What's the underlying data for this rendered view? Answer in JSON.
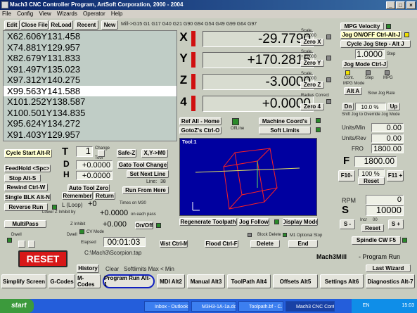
{
  "window": {
    "title": "Mach3 CNC Controller Program, ArtSoft Corporation, 2000 - 2004"
  },
  "menu": [
    "File",
    "Config",
    "View",
    "Wizards",
    "Operator",
    "Help"
  ],
  "toolbar": {
    "edit": "Edit",
    "close": "Close File",
    "reload": "ReLoad",
    "recent": "Recent",
    "new": "New"
  },
  "modal": "Mill->G15  G1 G17 G40 G21 G90 G94 G54 G49 G99 G64 G97",
  "gcode": [
    "X62.606Y131.458",
    "X74.881Y129.957",
    "X82.679Y131.833",
    "X91.497Y135.023",
    "X97.312Y140.275",
    "X99.563Y141.588",
    "X101.252Y138.587",
    "X100.501Y134.835",
    "X95.624Y134.272",
    "X91.403Y129.957"
  ],
  "gcode_selected": 5,
  "axes": [
    {
      "label": "X",
      "value": "-29.7790",
      "scale": "Scale",
      "scale_val": "+1.0000",
      "zero": "Zero X"
    },
    {
      "label": "Y",
      "value": "+170.2815",
      "scale": "Scale",
      "scale_val": "+1.0000",
      "zero": "Zero Y"
    },
    {
      "label": "Z",
      "value": "-3.0000",
      "scale": "Scale",
      "scale_val": "+1.0000",
      "zero": "Zero Z"
    },
    {
      "label": "4",
      "value": "+0.0000",
      "scale": "Radius Correct",
      "scale_val": "",
      "zero": "Zero 4"
    }
  ],
  "right": {
    "mpg_velocity": "MPG Velocity",
    "jog_toggle": "Jog ON/OFF Ctrl-Alt-J",
    "jog_step": "Cycle Jog Step - Alt J",
    "step_val": "1.0000",
    "step_label": "Step",
    "jog_mode": "Jog Mode Ctrl-J",
    "cont": "Cont.",
    "step": "Step",
    "mpg": "MPG",
    "mpg_mode": "MPG Mode",
    "alt_a": "Alt A",
    "slow_jog": "Slow Jog Rate",
    "minus": "Dn",
    "jog_pct": "10.0 %",
    "plus": "Up",
    "shift_jog": "Shift Jog to Override Jog Mode"
  },
  "ref": {
    "ref_all": "Ref All - Home",
    "goto_z": "GotoZ's Ctrl-O",
    "offline": "OffLine",
    "machine_coords": "Machine Coord's",
    "soft_limits": "Soft Limits"
  },
  "feed": {
    "units_min_label": "Units/Min",
    "units_min": "0.00",
    "units_rev_label": "Units/Rev",
    "units_rev": "0.00",
    "fro_label": "FRO",
    "fro": "1800.00",
    "f_label": "F",
    "f_val": "1800.00",
    "pct": "100 %",
    "reset": "Reset",
    "f10": "F10-",
    "f11": "F11 +"
  },
  "spindle": {
    "rpm_label": "RPM",
    "rpm": "0",
    "s_label": "S",
    "s_val": "10000",
    "minus": "S -",
    "plus": "S +",
    "incr": "Incr",
    "incr_val": "00",
    "reset": "Reset",
    "spindle_btn": "Spindle CW F5"
  },
  "cycle": {
    "start": "Cycle Start Alt-R",
    "feedhold": "FeedHold <Spc>",
    "stop": "Stop Alt-S",
    "rewind": "Rewind Ctrl-W",
    "single": "Single BLK Alt-N",
    "reverse": "Reverse Run",
    "multipass": "MultiPass",
    "dwell": "Dwell",
    "dwell2": "Dwell",
    "cv_mode": "CV Mode"
  },
  "tool": {
    "t_label": "T",
    "t_val": "1",
    "change": "Change",
    "d_label": "D",
    "d_val": "+0.0000",
    "h_label": "H",
    "h_val": "+0.0000",
    "safe_z": "Safe-Z",
    "xy_m0": "X,Y->M0",
    "gato": "Gato Tool Change",
    "set_next": "Set Next Line",
    "line_label": "Line:",
    "line_val": "38",
    "run_from": "Run From Here",
    "auto_zero": "Auto Tool Zero",
    "remember": "Remember",
    "return": "Return",
    "l_label": "L (Loop)",
    "l_val": "+0",
    "times_m30": "Times on M30",
    "lower_z": "Lower Z Inhibit by",
    "lower_val": "+0.0000",
    "each_pass": "on each pass",
    "z_inhibit": "Z Inhibit",
    "z_inhibit_val": "+0.000",
    "on_off": "On/Off",
    "tool_label": "Tool",
    "tool_val": "Tool"
  },
  "viewer": {
    "title": "Tool:1",
    "regen": "Regenerate Toolpath",
    "jog_follow": "Jog Follow",
    "display_mode": "Display Mode"
  },
  "bottom": {
    "elapsed_label": "Elapsed",
    "elapsed": "00:01:03",
    "mist": "Mist Ctrl-M",
    "flood": "Flood Ctrl-F",
    "delete": "Delete",
    "end": "End",
    "block_delete": "Block Delete",
    "m1_stop": "M1 Optional Stop",
    "file": "C:\\Mach3\\Scorpion.tap",
    "file2": "C:\\Mach3\\Scorpion.tap",
    "reset": "RESET",
    "history": "History",
    "clear": "Clear",
    "max_min": "Softlimits Max < Min",
    "mill": "Mach3Mill",
    "mode": "- Program Run",
    "last_wizard": "Last Wizard"
  },
  "tabs": [
    "Simplify Screen",
    "G-Codes",
    "M-Codes",
    "Program Run Alt-1",
    "MDI Alt2",
    "Manual Alt3",
    "ToolPath Alt4",
    "Offsets Alt5",
    "Settings Alt6",
    "Diagnostics Alt-7"
  ],
  "taskbar": {
    "start": "start",
    "tasks": [
      "Inbox - Outlook ...",
      "M3H3-1A-1a.do...",
      "Toolpath.bf - C...",
      "Mach3 CNC Contr..."
    ],
    "lang": "EN",
    "clock": "15:03"
  }
}
